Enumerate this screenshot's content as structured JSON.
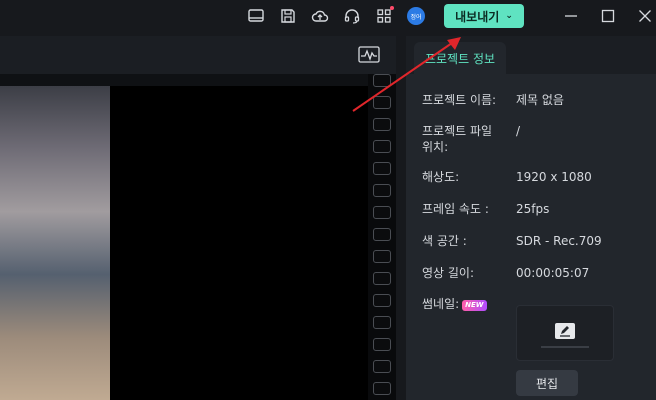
{
  "topbar": {
    "icons": [
      "monitor-icon",
      "save-icon",
      "cloud-upload-icon",
      "headset-icon",
      "grid-icon"
    ],
    "avatar_text": "정어",
    "export_label": "내보내기",
    "export_chevron": "⌄",
    "window": {
      "minimize": "—",
      "maximize": "☐",
      "close": "✕"
    }
  },
  "preview": {
    "header_icon": "waveform-icon"
  },
  "info": {
    "tab_label": "프로젝트 정보",
    "rows": [
      {
        "label": "프로젝트 이름:",
        "value": "제목 없음"
      },
      {
        "label": "프로젝트 파일\n위치:",
        "value": "/"
      },
      {
        "label": "해상도:",
        "value": "1920 x 1080"
      },
      {
        "label": "프레임 속도 :",
        "value": "25fps"
      },
      {
        "label": "색 공간 :",
        "value": "SDR - Rec.709"
      },
      {
        "label": "영상 길이:",
        "value": "00:00:05:07"
      },
      {
        "label": "썸네일:",
        "value": ""
      }
    ],
    "new_badge": "NEW",
    "edit_button": "편집"
  },
  "colors": {
    "accent": "#5fe3c1",
    "arrow": "#e0262b"
  }
}
